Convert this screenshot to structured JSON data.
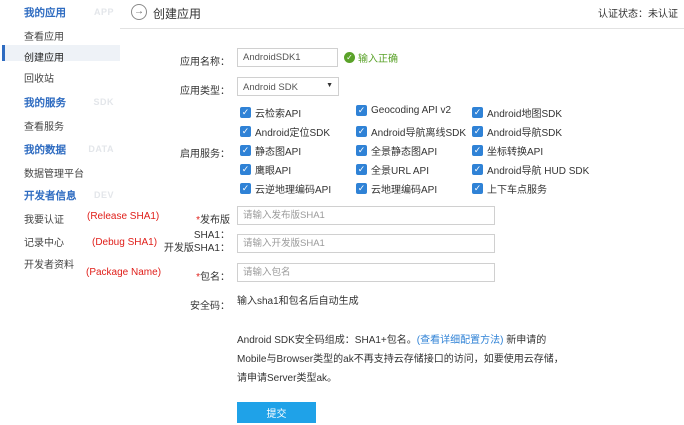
{
  "sidebar": {
    "sections": [
      {
        "title": "我的应用",
        "bg": "APP",
        "items": [
          "查看应用",
          "创建应用",
          "回收站"
        ]
      },
      {
        "title": "我的服务",
        "bg": "SDK",
        "items": [
          "查看服务"
        ]
      },
      {
        "title": "我的数据",
        "bg": "DATA",
        "items": [
          "数据管理平台"
        ]
      },
      {
        "title": "开发者信息",
        "bg": "DEV",
        "items": [
          "我要认证",
          "记录中心",
          "开发者资料"
        ]
      }
    ],
    "active_item": "创建应用"
  },
  "annotations": {
    "release": "(Release SHA1)",
    "debug": "(Debug SHA1)",
    "package": "(Package Name)"
  },
  "header": {
    "back_icon": "back-arrow-icon",
    "title": "创建应用",
    "auth_status": "认证状态：未认证"
  },
  "form": {
    "app_name_label": "应用名称：",
    "app_name_value": "AndroidSDK1",
    "app_name_valid": "输入正确",
    "app_type_label": "应用类型：",
    "app_type_value": "Android SDK",
    "services_label": "启用服务：",
    "services": [
      [
        "云检索API",
        "Geocoding API v2",
        "Android地图SDK"
      ],
      [
        "Android定位SDK",
        "Android导航离线SDK",
        "Android导航SDK"
      ],
      [
        "静态图API",
        "全景静态图API",
        "坐标转换API"
      ],
      [
        "鹰眼API",
        "全景URL API",
        "Android导航 HUD SDK"
      ],
      [
        "云逆地理编码API",
        "云地理编码API",
        "上下车点服务"
      ]
    ],
    "release_sha1_label": "发布版SHA1：",
    "release_sha1_placeholder": "请输入发布版SHA1",
    "debug_sha1_label": "开发版SHA1：",
    "debug_sha1_placeholder": "请输入开发版SHA1",
    "package_label": "包名：",
    "package_placeholder": "请输入包名",
    "security_label": "安全码：",
    "security_text": "输入sha1和包名后自动生成",
    "note_part1": "Android SDK安全码组成：SHA1+包名。",
    "note_link": "(查看详细配置方法)",
    "note_part2": " 新申请的Mobile与Browser类型的ak不再支持云存储接口的访问，如要使用云存储，请申请Server类型ak。",
    "submit_label": "提交"
  },
  "colors": {
    "accent": "#2f6cc1",
    "checkbox": "#2f82d6",
    "submit": "#1fa2e8",
    "valid": "#5aa229",
    "annotation": "#e0201b"
  }
}
